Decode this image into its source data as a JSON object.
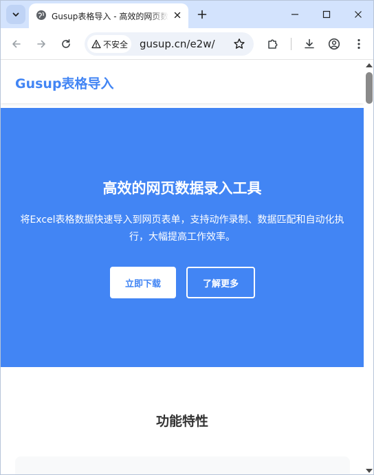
{
  "browser": {
    "tab_title": "Gusup表格导入 - 高效的网页数据录入工具",
    "security_label": "不安全",
    "url": "gusup.cn/e2w/",
    "icons": {
      "tab_search": "chevron-down-icon",
      "favicon": "globe-icon",
      "tab_close": "close-icon",
      "new_tab": "plus-icon",
      "minimize": "minimize-icon",
      "maximize": "maximize-icon",
      "close_window": "close-icon",
      "back": "arrow-left-icon",
      "forward": "arrow-right-icon",
      "reload": "reload-icon",
      "warning": "warning-icon",
      "bookmark": "star-icon",
      "extensions": "puzzle-icon",
      "downloads": "download-icon",
      "profile": "account-icon",
      "menu": "more-vert-icon"
    }
  },
  "site": {
    "logo": "Gusup表格导入"
  },
  "hero": {
    "title": "高效的网页数据录入工具",
    "description": "将Excel表格数据快速导入到网页表单，支持动作录制、数据匹配和自动化执行，大幅提高工作效率。",
    "primary_button": "立即下载",
    "secondary_button": "了解更多",
    "background_color": "#4285f4"
  },
  "features": {
    "title": "功能特性"
  },
  "colors": {
    "brand": "#4285f4",
    "tabstrip": "#d3e3fd",
    "text_dark": "#333333"
  }
}
